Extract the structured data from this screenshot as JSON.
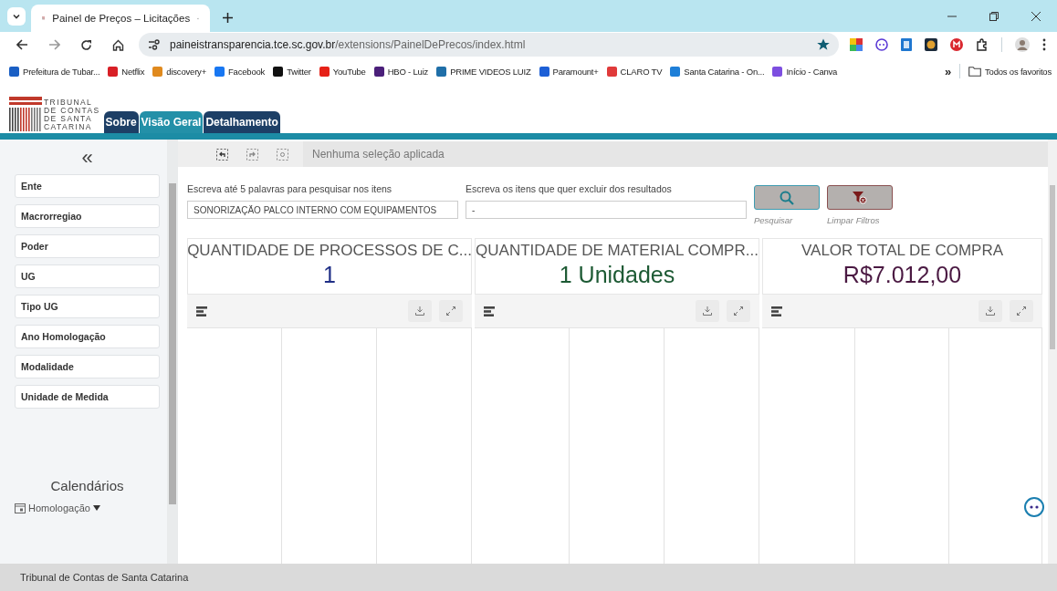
{
  "browser": {
    "tab": {
      "title": "Painel de Preços – Licitações",
      "selected": true
    },
    "address": {
      "domain": "paineistransparencia.tce.sc.gov.br",
      "path": "/extensions/PainelDePrecos/index.html"
    },
    "bookmarks": [
      {
        "label": "Prefeitura de Tubar...",
        "color": "#1a5fc4"
      },
      {
        "label": "Netflix",
        "color": "#d81f26"
      },
      {
        "label": "discovery+",
        "color": "#e08a1e"
      },
      {
        "label": "Facebook",
        "color": "#1877f2"
      },
      {
        "label": "Twitter",
        "color": "#111111"
      },
      {
        "label": "YouTube",
        "color": "#e62117"
      },
      {
        "label": "HBO - Luiz",
        "color": "#4b1f7a"
      },
      {
        "label": "PRIME VIDEOS LUIZ",
        "color": "#1f6fa8"
      },
      {
        "label": "Paramount+",
        "color": "#1d5fd6"
      },
      {
        "label": "CLARO TV",
        "color": "#e03a3a"
      },
      {
        "label": "Santa Catarina - On...",
        "color": "#1e7fd8"
      },
      {
        "label": "Início - Canva",
        "color": "#7d4ee0"
      }
    ],
    "overflow": "»",
    "all_bookmarks": "Todos os favoritos"
  },
  "app": {
    "logo": [
      "TRIBUNAL",
      "DE CONTAS",
      "DE SANTA",
      "CATARINA"
    ],
    "tabs": [
      {
        "label": "Sobre",
        "selected": false
      },
      {
        "label": "Visão Geral",
        "selected": true
      },
      {
        "label": "Detalhamento",
        "selected": false
      }
    ],
    "collapse": "«",
    "filters": [
      "Ente",
      "Macrorregiao",
      "Poder",
      "UG",
      "Tipo UG",
      "Ano Homologação",
      "Modalidade",
      "Unidade de Medida"
    ],
    "calendars": {
      "title": "Calendários",
      "item": "Homologação"
    },
    "selection_bar": "Nenhuma seleção aplicada",
    "search": {
      "include_label": "Escreva até 5 palavras para pesquisar nos itens",
      "include_value": "SONORIZAÇÃO PALCO INTERNO COM EQUIPAMENTOS",
      "exclude_label": "Escreva os itens que quer excluir dos resultados",
      "exclude_value": "-",
      "search_caption": "Pesquisar",
      "clear_caption": "Limpar Filtros"
    },
    "kpis": [
      {
        "title": "QUANTIDADE DE PROCESSOS DE C...",
        "value": "1",
        "color": "#1f2f86"
      },
      {
        "title": "QUANTIDADE DE MATERIAL COMPR...",
        "value": "1 Unidades",
        "color": "#1d5a34"
      },
      {
        "title": "VALOR TOTAL DE COMPRA",
        "value": "R$7.012,00",
        "color": "#4a1942"
      }
    ],
    "footer": "Tribunal de Contas de Santa Catarina"
  }
}
